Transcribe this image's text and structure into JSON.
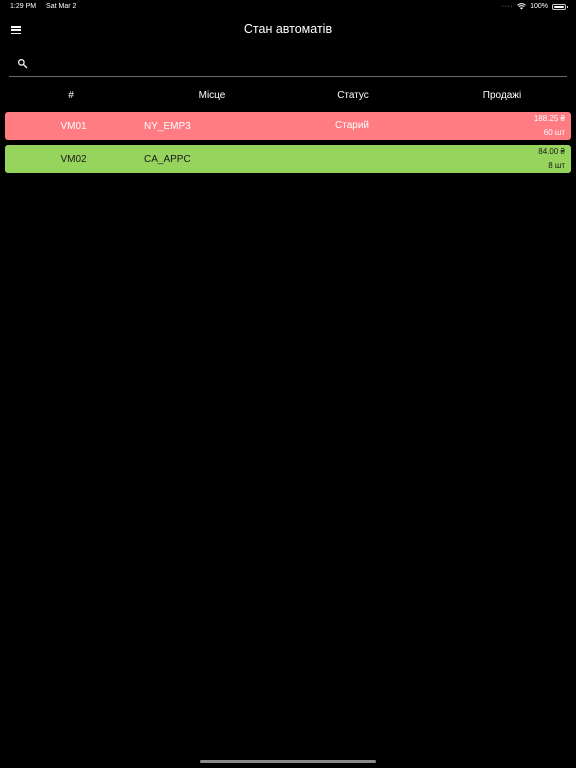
{
  "status_bar": {
    "time": "1:29 PM",
    "date": "Sat Mar 2",
    "dots": "····",
    "wifi_icon": "wifi-icon",
    "battery_percent": "100%",
    "battery_level": 1.0
  },
  "header": {
    "title": "Стан автоматів",
    "menu_icon": "hamburger-menu-icon"
  },
  "search": {
    "placeholder": "",
    "value": "",
    "icon": "search-icon"
  },
  "table": {
    "columns": [
      "#",
      "Місце",
      "Статус",
      "Продажі"
    ],
    "rows": [
      {
        "id": "VM01",
        "place": "NY_EMP3",
        "status": "Старий",
        "amount": "188.25 ₴",
        "count": "60 шт",
        "color": "#ff7c83"
      },
      {
        "id": "VM02",
        "place": "CA_APPC",
        "status": "",
        "amount": "84.00 ₴",
        "count": "8 шт",
        "color": "#96d45d"
      }
    ]
  },
  "colors": {
    "background": "#000000",
    "row_old": "#ff7c83",
    "row_ok": "#96d45d"
  }
}
